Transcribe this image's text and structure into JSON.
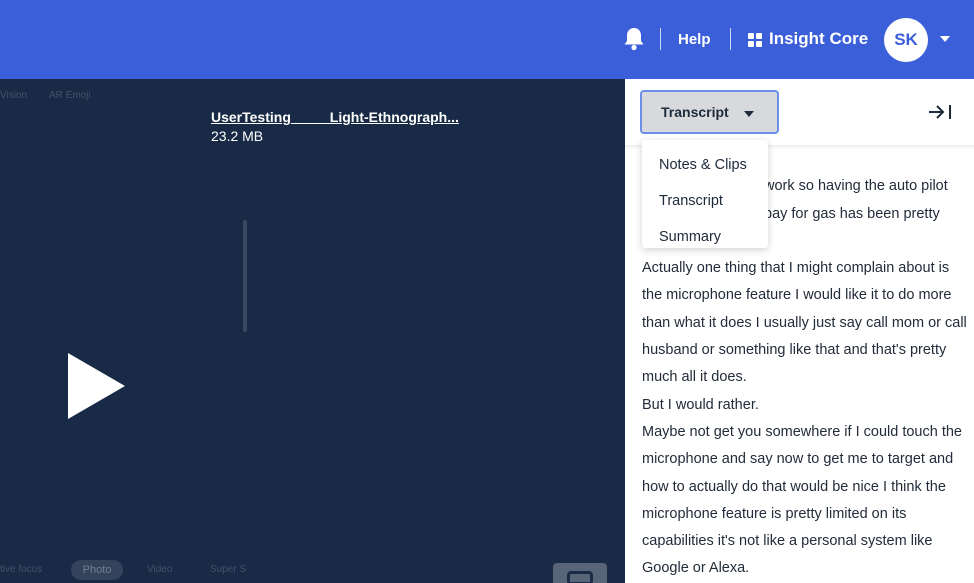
{
  "header": {
    "help_label": "Help",
    "workspace_label": "Insight Core",
    "avatar_initials": "SK",
    "accent_color": "#3a5fd9"
  },
  "video": {
    "file_name": "UserTesting_____Light-Ethnograph...",
    "file_size": "23.2 MB",
    "background_labels": [
      "Vision",
      "AR Emoji",
      "tive focus",
      "Photo",
      "Video",
      "Super S"
    ]
  },
  "panel": {
    "selected_view": "Transcript",
    "menu_options": [
      "Notes & Clips",
      "Transcript",
      "Summary"
    ],
    "transcript_partial": [
      "work so having the auto pilot",
      "pay for gas has been pretty"
    ],
    "transcript_lines": [
      "Actually one thing that I might complain about is the microphone feature I would like it to do more than what it does I usually just say call mom or call husband or something like that and that's pretty much all it does.",
      "But I would rather.",
      "Maybe not get you somewhere if I could touch the microphone and say now to get me to target and how to actually do that would be nice I think the microphone feature is pretty limited on its capabilities it's not like a personal system like Google or Alexa."
    ]
  }
}
